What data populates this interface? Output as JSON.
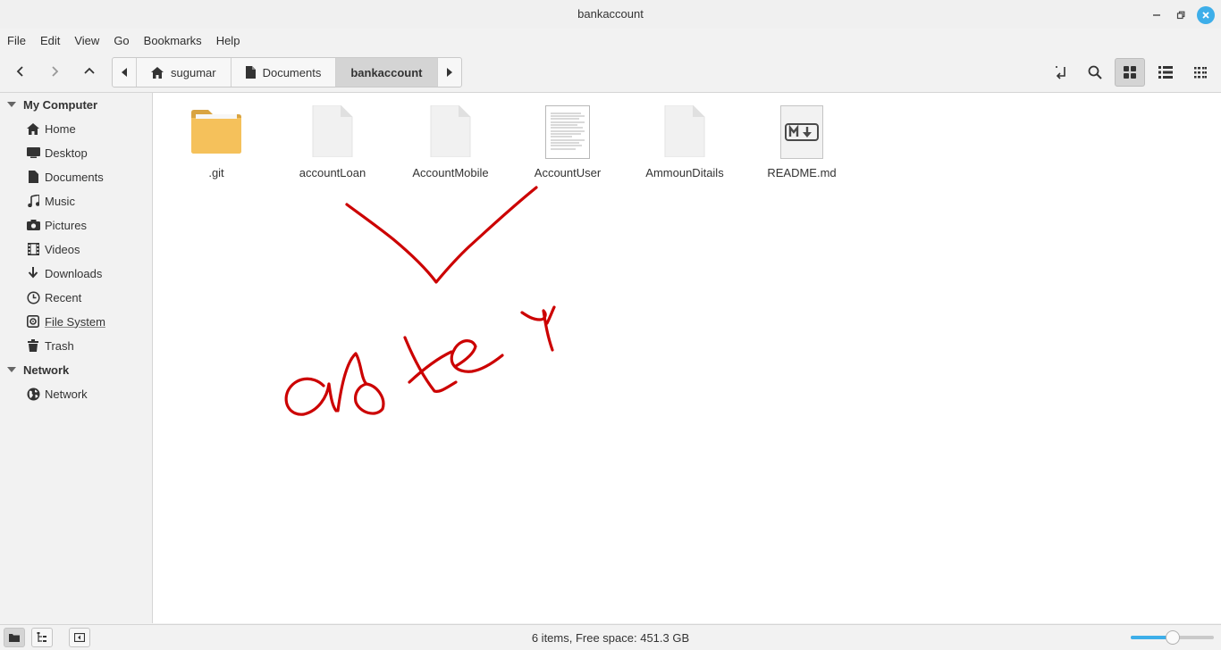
{
  "window": {
    "title": "bankaccount"
  },
  "menu": [
    "File",
    "Edit",
    "View",
    "Go",
    "Bookmarks",
    "Help"
  ],
  "pathbar": {
    "segments": [
      "sugumar",
      "Documents",
      "bankaccount"
    ]
  },
  "sidebar": {
    "my_computer": "My Computer",
    "items": [
      {
        "label": "Home",
        "icon": "home-icon"
      },
      {
        "label": "Desktop",
        "icon": "desktop-icon"
      },
      {
        "label": "Documents",
        "icon": "document-icon"
      },
      {
        "label": "Music",
        "icon": "music-icon"
      },
      {
        "label": "Pictures",
        "icon": "camera-icon"
      },
      {
        "label": "Videos",
        "icon": "film-icon"
      },
      {
        "label": "Downloads",
        "icon": "download-icon"
      },
      {
        "label": "Recent",
        "icon": "clock-icon"
      },
      {
        "label": "File System",
        "icon": "drive-icon"
      },
      {
        "label": "Trash",
        "icon": "trash-icon"
      }
    ],
    "network_header": "Network",
    "network_items": [
      {
        "label": "Network",
        "icon": "globe-icon"
      }
    ]
  },
  "files": [
    {
      "name": ".git",
      "type": "folder"
    },
    {
      "name": "accountLoan",
      "type": "blank"
    },
    {
      "name": "AccountMobile",
      "type": "blank"
    },
    {
      "name": "AccountUser",
      "type": "text"
    },
    {
      "name": "AmmounDitails",
      "type": "blank"
    },
    {
      "name": "README.md",
      "type": "markdown"
    }
  ],
  "annotation": {
    "text": "after",
    "color": "#cc0000"
  },
  "colors": {
    "accent": "#3daee9",
    "folder": "#f5c15b"
  },
  "status": {
    "text": "6 items, Free space: 451.3 GB",
    "zoom_fraction": 0.5
  }
}
